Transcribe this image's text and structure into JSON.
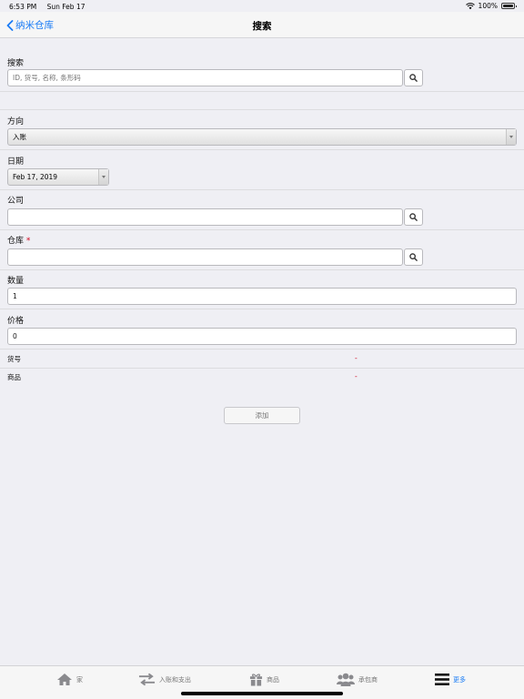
{
  "status_bar": {
    "time": "6:53 PM",
    "date": "Sun Feb 17",
    "battery": "100%",
    "icons": [
      "wifi-icon",
      "battery-icon"
    ]
  },
  "nav": {
    "back_label": "纳米仓库",
    "title": "搜索",
    "back_icon": "chevron-left-icon"
  },
  "form": {
    "search": {
      "label": "搜索",
      "placeholder": "ID, 货号, 名称, 条形码",
      "value": ""
    },
    "direction": {
      "label": "方向",
      "selected": "入账"
    },
    "date": {
      "label": "日期",
      "selected": "Feb 17, 2019"
    },
    "company": {
      "label": "公司",
      "value": ""
    },
    "warehouse": {
      "label": "仓库",
      "required_mark": "*",
      "value": ""
    },
    "quantity": {
      "label": "数量",
      "value": "1"
    },
    "price": {
      "label": "价格",
      "value": "0"
    },
    "article_no": {
      "label": "货号",
      "value": "-"
    },
    "product": {
      "label": "商品",
      "value": "-"
    },
    "add_button": "添加"
  },
  "tab_bar": {
    "tabs": [
      {
        "label": "家",
        "icon": "home-icon",
        "active": false
      },
      {
        "label": "入账和支出",
        "icon": "transfer-arrows-icon",
        "active": false
      },
      {
        "label": "商品",
        "icon": "gift-icon",
        "active": false
      },
      {
        "label": "承包商",
        "icon": "users-icon",
        "active": false
      },
      {
        "label": "更多",
        "icon": "menu-icon",
        "active": true
      }
    ]
  },
  "colors": {
    "accent": "#1a7cf5",
    "required": "#d0021b",
    "background": "#efeff4"
  }
}
